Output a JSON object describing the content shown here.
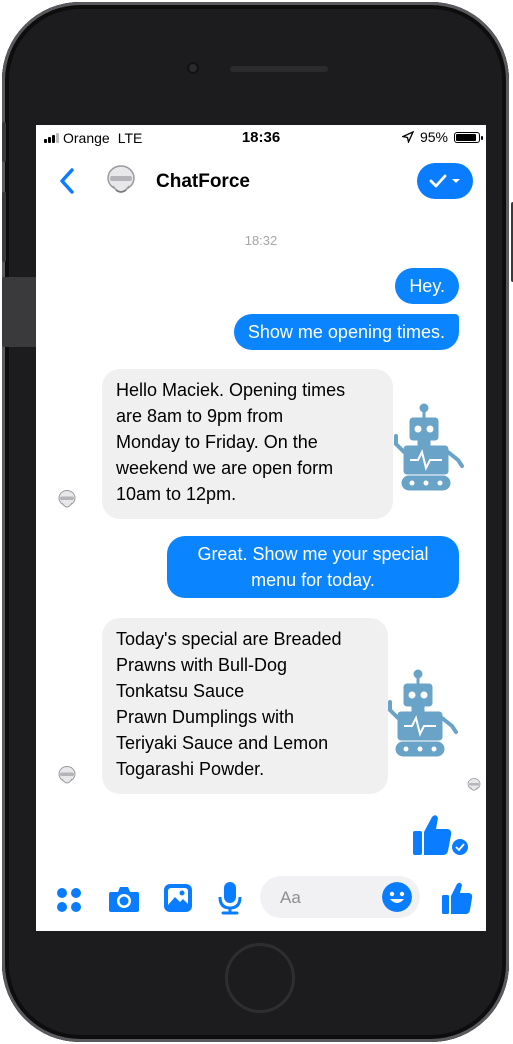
{
  "status_bar": {
    "carrier": "Orange",
    "network": "LTE",
    "time": "18:36",
    "battery": "95%",
    "battery_level": 0.95
  },
  "header": {
    "title": "ChatForce"
  },
  "timestamp": "18:32",
  "messages": [
    {
      "from": "user",
      "text": "Hey."
    },
    {
      "from": "user",
      "text": "Show me opening times."
    },
    {
      "from": "bot",
      "lines": [
        "Hello Maciek. Opening times",
        "are 8am to 9pm from",
        "Monday to Friday. On the",
        "weekend we are open form",
        "10am to 12pm."
      ]
    },
    {
      "from": "user",
      "lines": [
        "Great. Show me your special",
        "menu for today."
      ]
    },
    {
      "from": "bot",
      "lines": [
        "Today's special are Breaded",
        "Prawns with Bull-Dog",
        "Tonkatsu Sauce",
        "Prawn Dumplings with",
        "Teriyaki Sauce and Lemon",
        "Togarashi Powder."
      ]
    }
  ],
  "composer": {
    "placeholder": "Aa"
  },
  "colors": {
    "accent": "#0a7cff",
    "bubble_out": "#0a84ff",
    "bubble_in": "#f0f0f0",
    "robot": "#6aa3c8"
  },
  "icons": {
    "back": "chevron-left-icon",
    "more": "grid-dots-icon",
    "camera": "camera-icon",
    "gallery": "image-icon",
    "mic": "microphone-icon",
    "emoji": "smiley-icon",
    "like": "thumbs-up-icon"
  }
}
